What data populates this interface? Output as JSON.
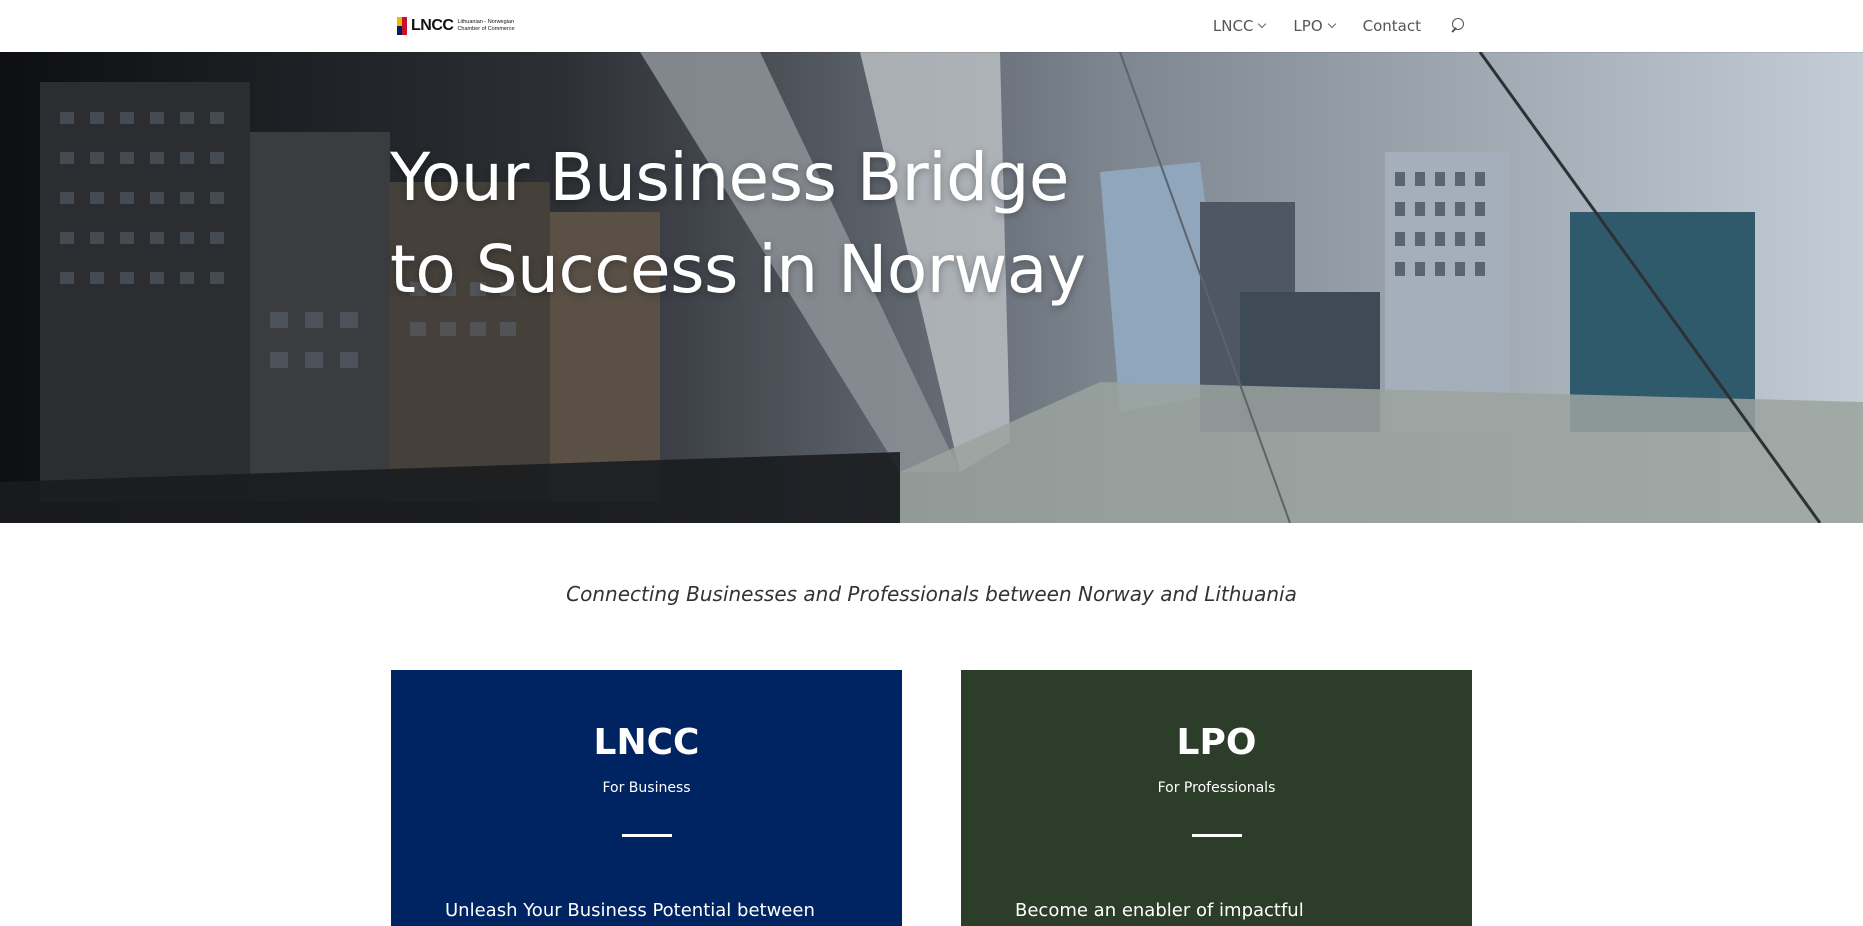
{
  "header": {
    "logo": {
      "name": "LNCC",
      "tagline_line1": "Lithuanian - Norwegian",
      "tagline_line2": "Chamber of Commerce"
    },
    "nav": [
      {
        "label": "LNCC",
        "has_dropdown": true,
        "icon": "chevron-down-icon"
      },
      {
        "label": "LPO",
        "has_dropdown": true,
        "icon": "chevron-down-icon"
      },
      {
        "label": "Contact",
        "has_dropdown": false
      }
    ],
    "search_icon": "search-icon"
  },
  "hero": {
    "title_line1": "Your Business Bridge",
    "title_line2": "to Success in Norway",
    "background": "city-bridge-photo"
  },
  "tagline": "Connecting Businesses and Professionals between Norway and Lithuania",
  "cards": [
    {
      "title": "LNCC",
      "subtitle": "For Business",
      "text": "Unleash Your Business Potential between",
      "color": "#002361"
    },
    {
      "title": "LPO",
      "subtitle": "For Professionals",
      "text": "Become an enabler of impactful",
      "color": "#2c3e29"
    }
  ]
}
